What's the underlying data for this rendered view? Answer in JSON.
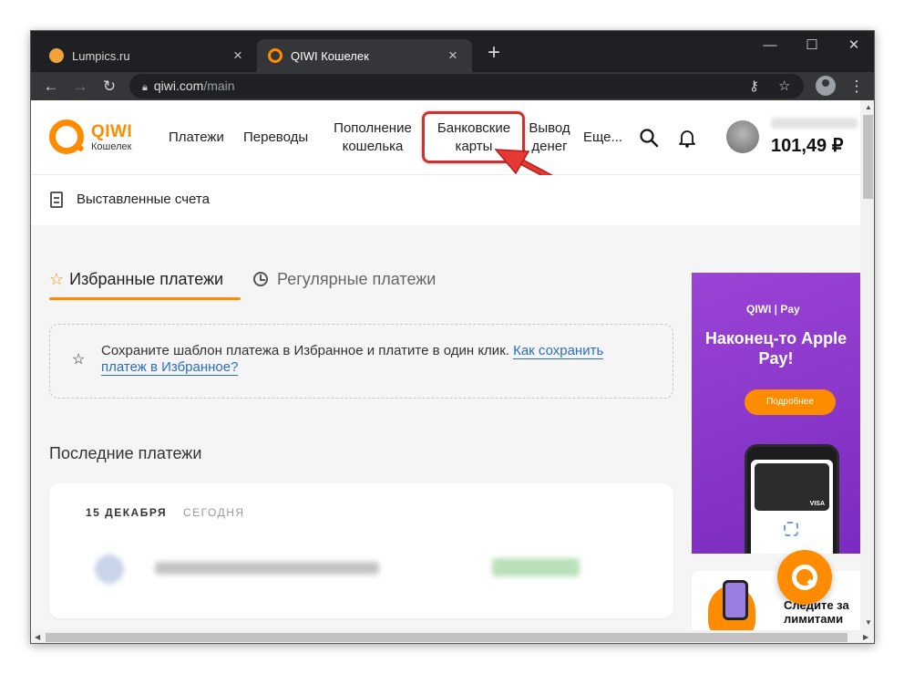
{
  "browser": {
    "tabs": [
      {
        "title": "Lumpics.ru",
        "close": "×"
      },
      {
        "title": "QIWI Кошелек",
        "close": "×"
      }
    ],
    "new_tab": "+",
    "window_controls": {
      "minimize": "—",
      "maximize": "☐",
      "close": "✕"
    },
    "address": {
      "host": "qiwi.com",
      "path": "/main"
    },
    "icons": [
      "back-arrow-icon",
      "forward-arrow-icon",
      "reload-icon",
      "lock-icon",
      "key-icon",
      "star-icon",
      "profile-icon",
      "menu-dots-icon"
    ]
  },
  "header": {
    "logo_text": "QIWI",
    "logo_sub": "Кошелек",
    "nav": [
      {
        "label": "Платежи"
      },
      {
        "label": "Переводы"
      },
      {
        "label": "Пополнение кошелька"
      },
      {
        "label": "Банковские карты",
        "highlighted": true
      },
      {
        "label": "Вывод денег"
      },
      {
        "label": "Еще..."
      }
    ],
    "balance": "101,49 ₽",
    "accent_color": "#ff8c00",
    "highlight_color": "#d32f2f"
  },
  "subheader": {
    "label": "Выставленные счета"
  },
  "tabs": {
    "favorites": "Избранные платежи",
    "regular": "Регулярные платежи",
    "active": "favorites"
  },
  "hint": {
    "text": "Сохраните шаблон платежа в Избранное и платите в один клик. ",
    "link": "Как сохранить платеж в Избранное?"
  },
  "recent": {
    "title": "Последние платежи",
    "date": "15 ДЕКАБРЯ",
    "today": "СЕГОДНЯ"
  },
  "promo": {
    "brand": "QIWI | Pay",
    "title": "Наконец-то Apple Pay!",
    "button": "Подробнее",
    "card_brand": "VISA"
  },
  "promo2": {
    "text": "Следите за лимитами"
  }
}
